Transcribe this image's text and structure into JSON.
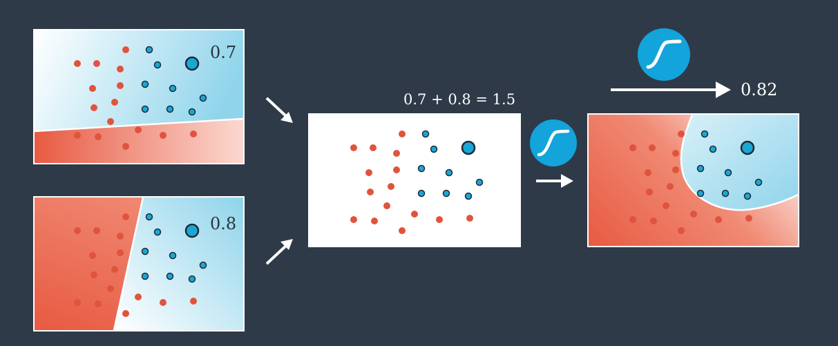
{
  "panel_top": {
    "score": "0.7"
  },
  "panel_bottom": {
    "score": "0.8"
  },
  "combine": {
    "equation": "0.7 + 0.8 = 1.5"
  },
  "output": {
    "score": "0.82"
  },
  "icons": {
    "sigmoid": "sigmoid-icon",
    "arrow": "arrow-icon"
  },
  "colors": {
    "background": "#2e3a48",
    "red_point": "#e0533d",
    "blue_point": "#1aa7d6",
    "red_region": "#e85a42",
    "blue_region": "#8fd4eb",
    "sigmoid_fill": "#12a4da"
  }
}
